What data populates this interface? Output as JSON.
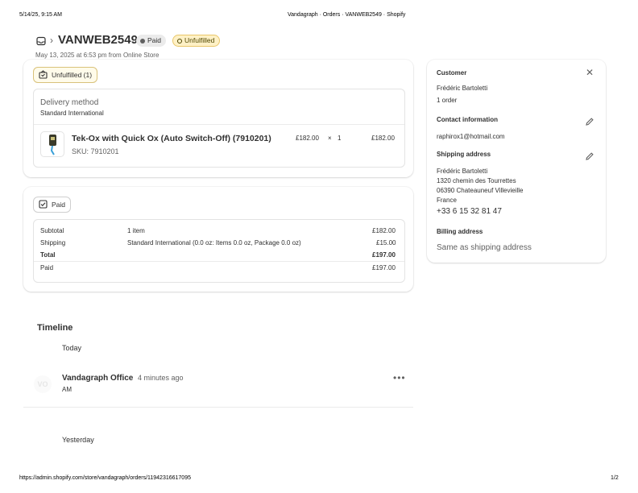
{
  "print": {
    "datetime": "5/14/25, 9:15 AM",
    "page_title": "Vandagraph · Orders · VANWEB2549 · Shopify",
    "url": "https://admin.shopify.com/store/vandagraph/orders/11942316617095",
    "page_num": "1/2"
  },
  "order": {
    "number": "VANWEB2549",
    "payment_badge": "Paid",
    "fulfillment_badge": "Unfulfilled",
    "meta": "May 13, 2025 at 6:53 pm from Online Store"
  },
  "fulfillment": {
    "status_label": "Unfulfilled (1)",
    "delivery_method_title": "Delivery method",
    "delivery_method_value": "Standard International",
    "item": {
      "name": "Tek-Ox with Quick Ox (Auto Switch-Off) (7910201)",
      "sku": "SKU: 7910201",
      "unit_price": "£182.00",
      "times": "×",
      "qty": "1",
      "total": "£182.00"
    }
  },
  "payment": {
    "status_label": "Paid",
    "rows": [
      {
        "label": "Subtotal",
        "detail": "1 item",
        "amount": "£182.00"
      },
      {
        "label": "Shipping",
        "detail": "Standard International (0.0 oz: Items 0.0 oz, Package 0.0 oz)",
        "amount": "£15.00"
      },
      {
        "label": "Total",
        "detail": "",
        "amount": "£197.00"
      },
      {
        "label": "Paid",
        "detail": "",
        "amount": "£197.00"
      }
    ]
  },
  "timeline": {
    "title": "Timeline",
    "today_label": "Today",
    "avatar_initials": "VO",
    "event_author": "Vandagraph Office",
    "event_time": "4 minutes ago",
    "event_sub": "AM",
    "yesterday_label": "Yesterday"
  },
  "customer": {
    "section_title": "Customer",
    "name": "Frédéric Bartoletti",
    "orders": "1 order",
    "contact_title": "Contact information",
    "email": "raphirox1@hotmail.com",
    "shipping_title": "Shipping address",
    "address_lines": [
      "Frédéric Bartoletti",
      "1320 chemin des Tourrettes",
      "06390 Chateauneuf Villevieille",
      "France"
    ],
    "phone": "+33 6 15 32 81 47",
    "billing_title": "Billing address",
    "billing_value": "Same as shipping address"
  },
  "colors": {
    "unfulfilled_badge_bg": "#fff1c6",
    "unfulfilled_badge_border": "#e8c76a",
    "paid_badge_bg": "#ebebeb",
    "text": "#303030",
    "muted": "#616161"
  }
}
